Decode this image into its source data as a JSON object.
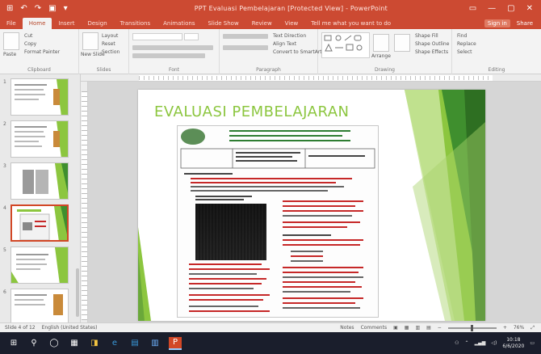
{
  "window": {
    "title": "PPT Evaluasi Pembelajaran [Protected View] - PowerPoint",
    "qat": [
      "⊞",
      "↶",
      "↷",
      "▣",
      "▾"
    ],
    "controls": [
      "▭",
      "—",
      "▢",
      "✕"
    ]
  },
  "tabs": [
    "File",
    "Home",
    "Insert",
    "Design",
    "Transitions",
    "Animations",
    "Slide Show",
    "Review",
    "View",
    "Tell me what you want to do"
  ],
  "active_tab": "Home",
  "tabs_right": {
    "signin": "Sign in",
    "share": "Share"
  },
  "ribbon": {
    "groups": [
      "Clipboard",
      "Slides",
      "Font",
      "Paragraph",
      "Drawing",
      "Editing"
    ],
    "paste": "Paste",
    "cut": "Cut",
    "copy": "Copy",
    "format_painter": "Format Painter",
    "new_slide": "New Slide",
    "layout": "Layout",
    "reset": "Reset",
    "section": "Section",
    "text_direction": "Text Direction",
    "align_text": "Align Text",
    "convert_smartart": "Convert to SmartArt",
    "arrange": "Arrange",
    "quick_styles": "Quick Styles",
    "shape_fill": "Shape Fill",
    "shape_outline": "Shape Outline",
    "shape_effects": "Shape Effects",
    "find": "Find",
    "replace": "Replace",
    "select": "Select"
  },
  "slides": {
    "count": 6,
    "selected_index": 4,
    "numbers": [
      "1",
      "2",
      "3",
      "4",
      "5",
      "6"
    ]
  },
  "slide": {
    "title": "EVALUASI PEMBELAJARAN",
    "accent_color": "#8cc63f",
    "dark_green": "#2e7d32"
  },
  "statusbar": {
    "slide_info": "Slide 4 of 12",
    "language": "English (United States)",
    "notes": "Notes",
    "comments": "Comments",
    "zoom": "76%"
  },
  "taskbar": {
    "start": "⊞",
    "apps": [
      "⚲",
      "◯",
      "▦",
      "◨",
      "e",
      "▤",
      "▥",
      "P"
    ],
    "time": "10:18",
    "date": "6/6/2020"
  }
}
